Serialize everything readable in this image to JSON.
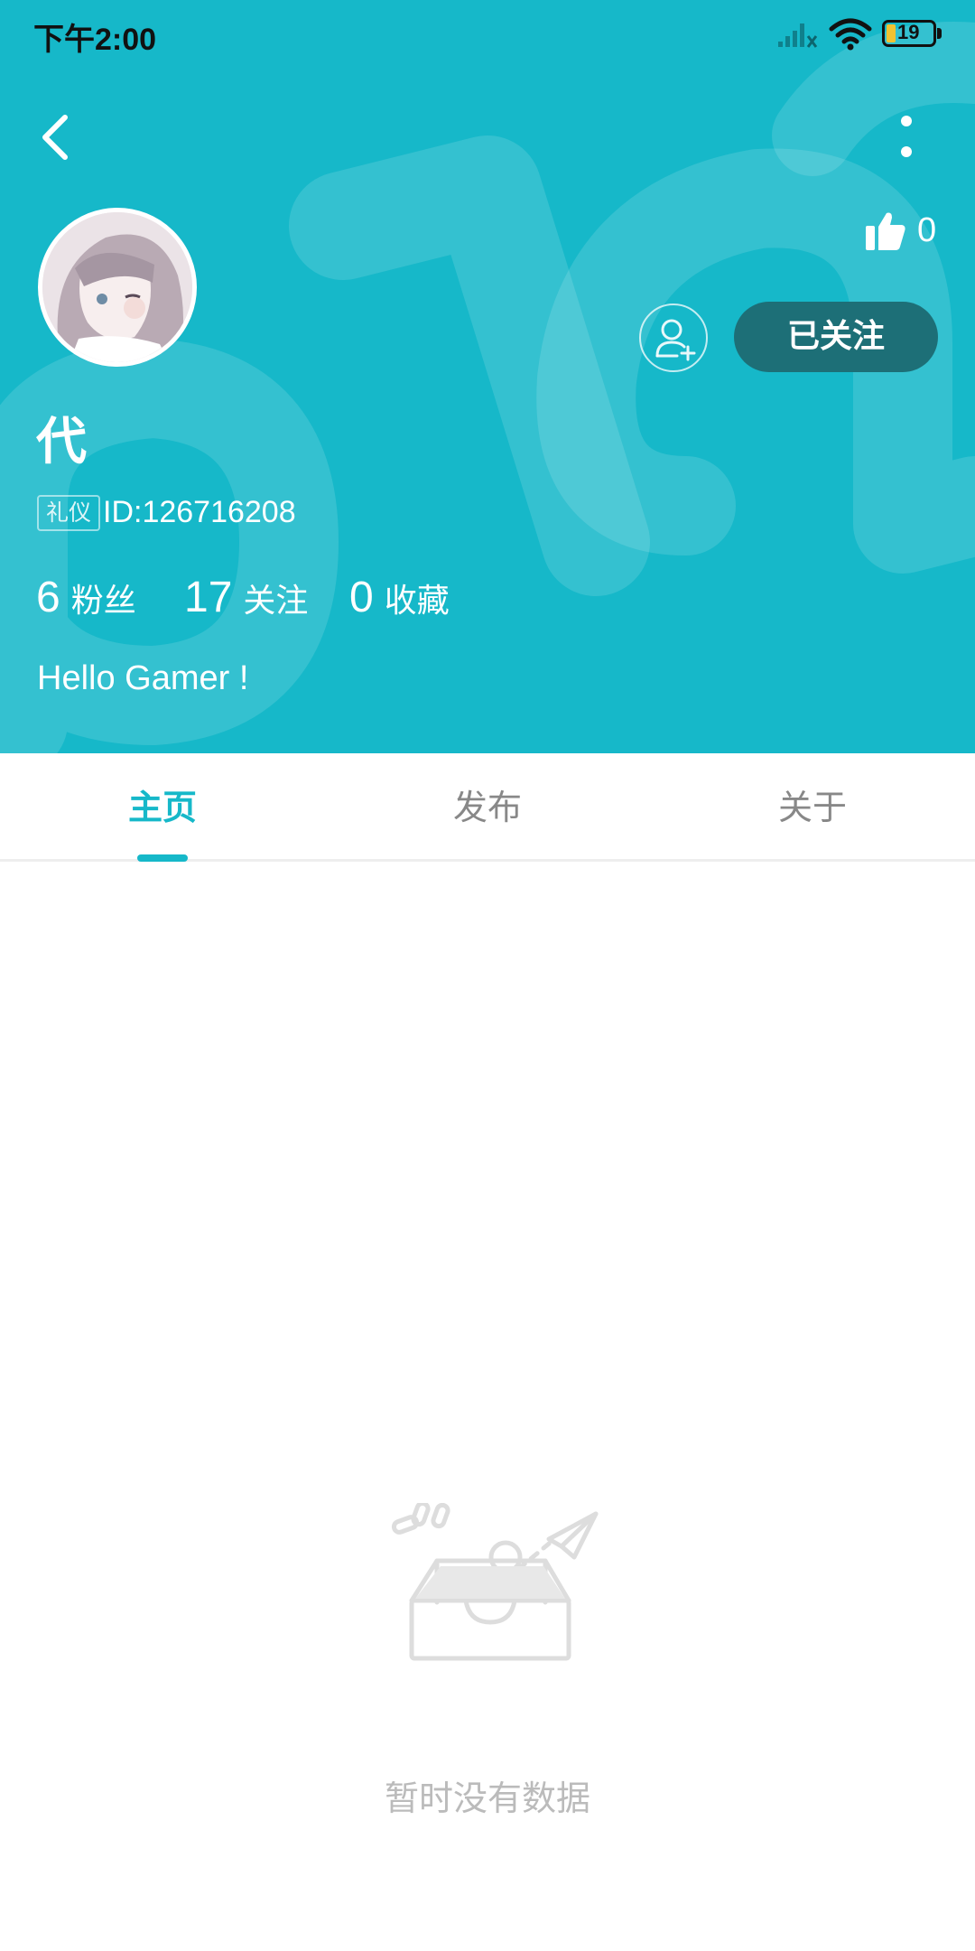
{
  "status_bar": {
    "time": "下午2:00",
    "battery_level": "19",
    "battery_accent": "#f1c232"
  },
  "colors": {
    "accent": "#16b8c9",
    "follow_button": "#1d6f77",
    "empty_text": "#bbbbbb",
    "tab_inactive": "#888888"
  },
  "header": {
    "back_icon": "chevron-left-icon",
    "more_icon": "more-vertical-icon"
  },
  "profile": {
    "likes": "0",
    "follow_label": "已关注",
    "username": "代",
    "tag": "礼仪",
    "user_id": "ID:126716208",
    "stats": [
      {
        "value": "6",
        "label": "粉丝"
      },
      {
        "value": "17",
        "label": "关注"
      },
      {
        "value": "0",
        "label": "收藏"
      }
    ],
    "bio": "Hello Gamer !"
  },
  "tabs": [
    {
      "label": "主页",
      "active": true
    },
    {
      "label": "发布",
      "active": false
    },
    {
      "label": "关于",
      "active": false
    }
  ],
  "empty_state": {
    "message": "暂时没有数据",
    "icon": "empty-inbox-paper-plane-icon"
  }
}
